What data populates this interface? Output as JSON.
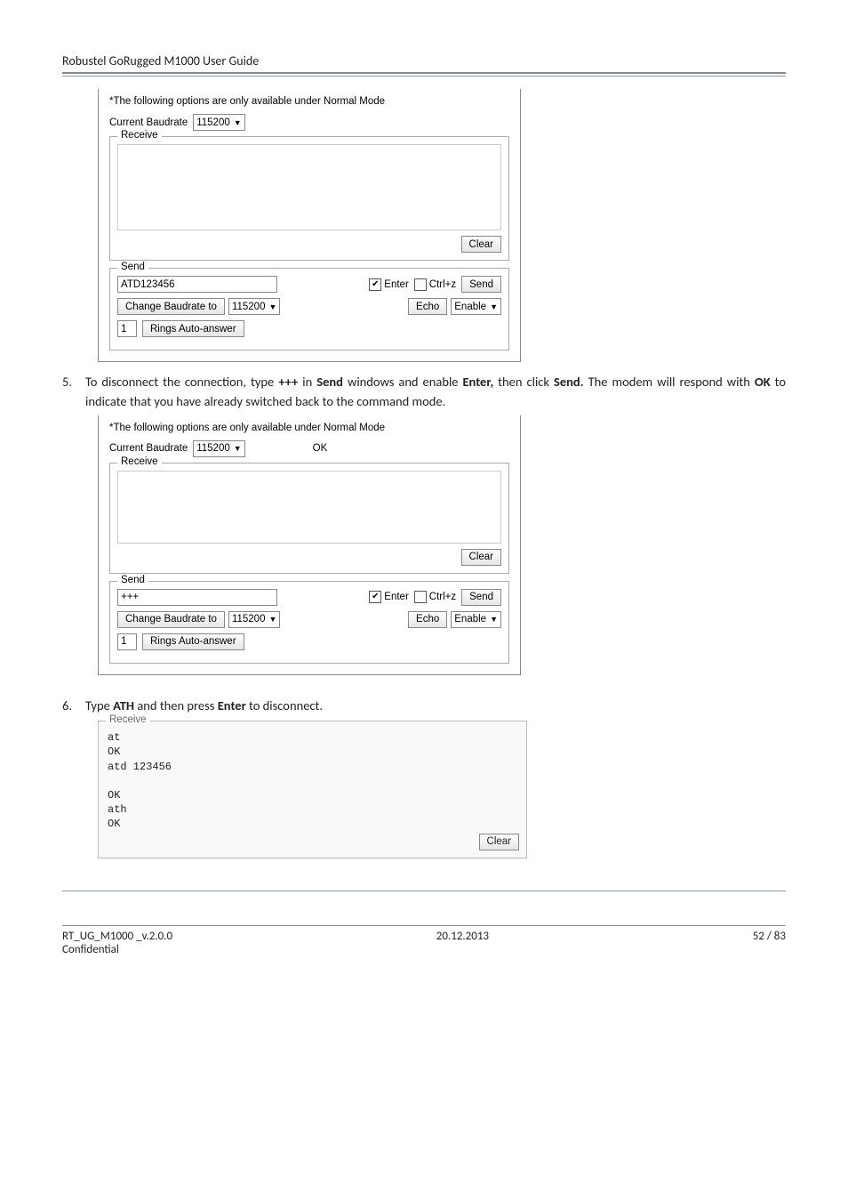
{
  "header": {
    "title": "Robustel GoRugged M1000 User Guide"
  },
  "fig1": {
    "note": "*The following options are only available under Normal Mode",
    "baud_label": "Current Baudrate",
    "baud_value": "115200",
    "receive_legend": "Receive",
    "clear": "Clear",
    "send_legend": "Send",
    "send_value": "ATD123456",
    "enter_label": "Enter",
    "ctrlz_label": "Ctrl+z",
    "send_btn": "Send",
    "change_baud_btn": "Change Baudrate to",
    "change_baud_value": "115200",
    "echo_btn": "Echo",
    "echo_value": "Enable",
    "rings_value": "1",
    "rings_btn": "Rings Auto-answer"
  },
  "step5": {
    "num": "5.",
    "text_a": "To disconnect the connection, type ",
    "plus": "+++",
    "text_b": " in ",
    "send_w": "Send",
    "text_c": " windows and enable ",
    "enter_w": "Enter,",
    "text_d": " then click ",
    "send_w2": "Send.",
    "text_e": " The modem will respond with ",
    "ok_w": "OK",
    "text_f": " to indicate that you have already switched back to the command mode."
  },
  "fig2": {
    "note": "*The following options are only available under Normal Mode",
    "baud_label": "Current Baudrate",
    "baud_value": "115200",
    "ok_text": "OK",
    "receive_legend": "Receive",
    "clear": "Clear",
    "send_legend": "Send",
    "send_value": "+++",
    "enter_label": "Enter",
    "ctrlz_label": "Ctrl+z",
    "send_btn": "Send",
    "change_baud_btn": "Change Baudrate to",
    "change_baud_value": "115200",
    "echo_btn": "Echo",
    "echo_value": "Enable",
    "rings_value": "1",
    "rings_btn": "Rings Auto-answer"
  },
  "step6": {
    "num": "6.",
    "text_a": "Type ",
    "ath_w": "ATH",
    "text_b": " and then press ",
    "enter_w": "Enter",
    "text_c": " to disconnect."
  },
  "fig3": {
    "legend": "Receive",
    "content": "at\nOK\natd 123456\n\nOK\nath\nOK",
    "clear": "Clear"
  },
  "footer": {
    "left1": "RT_UG_M1000 _v.2.0.0",
    "left2": "Confidential",
    "center": "20.12.2013",
    "right": "52 / 83"
  }
}
